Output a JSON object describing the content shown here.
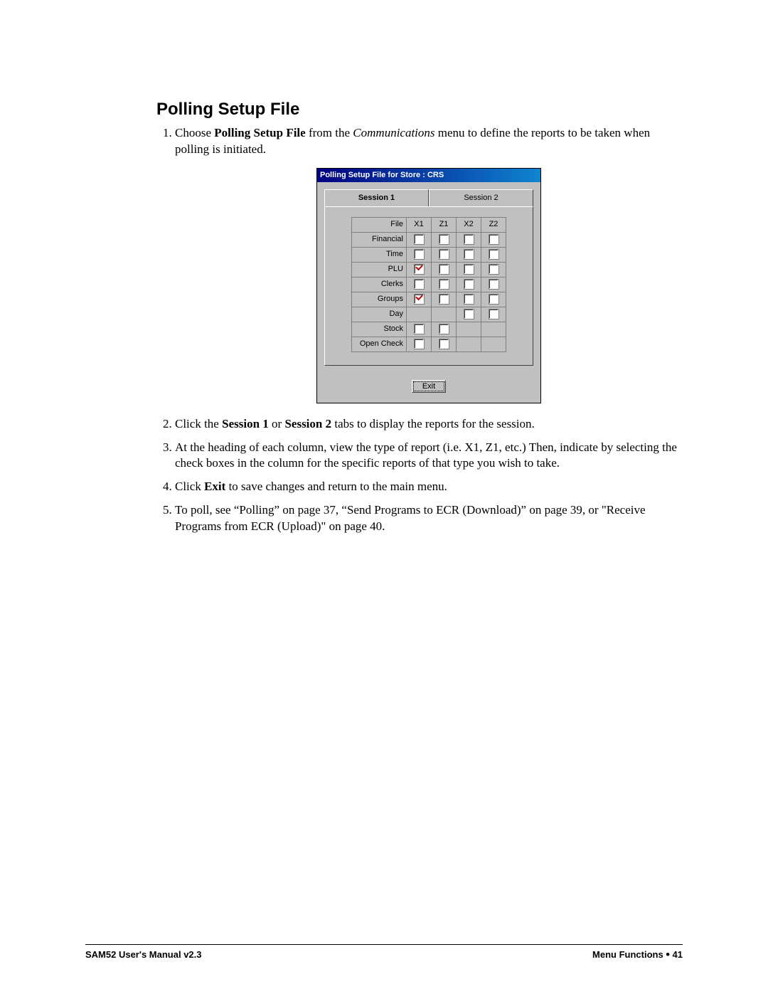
{
  "heading": "Polling Setup File",
  "steps": {
    "s1_a": "Choose ",
    "s1_b": "Polling Setup File",
    "s1_c": " from the ",
    "s1_d": "Communications",
    "s1_e": " menu to define the reports to be taken when polling is initiated.",
    "s2_a": "Click the ",
    "s2_b": "Session 1",
    "s2_c": " or ",
    "s2_d": "Session 2",
    "s2_e": " tabs to display the reports for the session.",
    "s3": "At the heading of each column, view the type of report (i.e. X1, Z1, etc.)  Then, indicate by selecting the check boxes in the column for the specific reports of that type you wish to take.",
    "s4_a": "Click ",
    "s4_b": "Exit",
    "s4_c": " to save changes and return to the main menu.",
    "s5": "To poll, see “Polling” on page 37, “Send Programs to ECR (Download)” on page 39, or \"Receive Programs from ECR (Upload)\" on page 40."
  },
  "dialog": {
    "title": "Polling Setup File for Store : CRS",
    "tabs": {
      "t1": "Session 1",
      "t2": "Session 2"
    },
    "columns": {
      "file": "File",
      "x1": "X1",
      "z1": "Z1",
      "x2": "X2",
      "z2": "Z2"
    },
    "rows": [
      {
        "label": "Financial",
        "cells": [
          "u",
          "u",
          "u",
          "u"
        ]
      },
      {
        "label": "Time",
        "cells": [
          "u",
          "u",
          "u",
          "u"
        ]
      },
      {
        "label": "PLU",
        "cells": [
          "c",
          "u",
          "u",
          "u"
        ]
      },
      {
        "label": "Clerks",
        "cells": [
          "u",
          "u",
          "u",
          "u"
        ]
      },
      {
        "label": "Groups",
        "cells": [
          "c",
          "u",
          "u",
          "u"
        ]
      },
      {
        "label": "Day",
        "cells": [
          "",
          "",
          "u",
          "u"
        ]
      },
      {
        "label": "Stock",
        "cells": [
          "u",
          "u",
          "",
          ""
        ]
      },
      {
        "label": "Open Check",
        "cells": [
          "u",
          "u",
          "",
          ""
        ]
      }
    ],
    "exit": "Exit"
  },
  "footer": {
    "left": "SAM52 User's Manual v2.3",
    "right_a": "Menu Functions  ",
    "right_b": "•",
    "right_c": "  41"
  }
}
